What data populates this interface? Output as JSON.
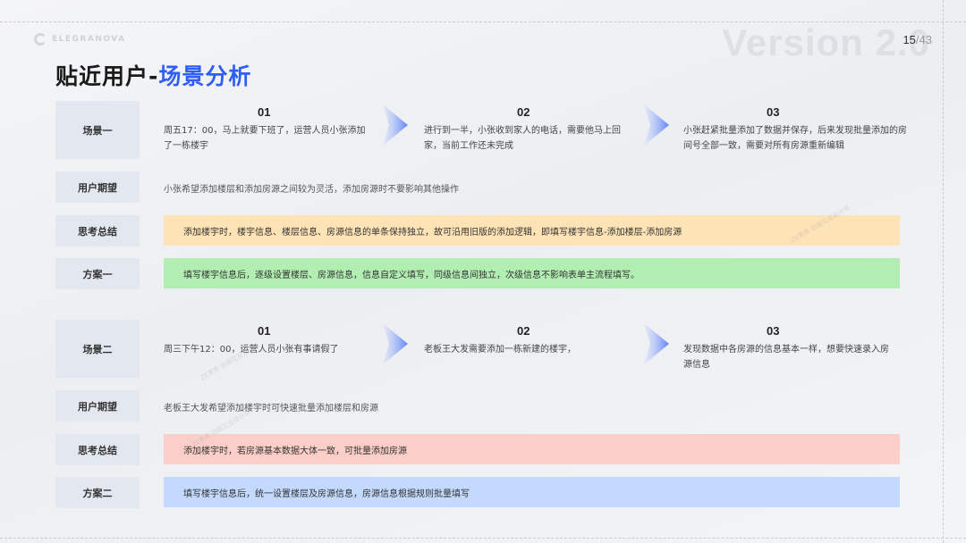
{
  "brand": {
    "logo_text": "ELEGRANOVA"
  },
  "watermark": {
    "version": "Version 2.0",
    "tiny": "ZE青秀 旧版交互设计师"
  },
  "page": {
    "current": "15",
    "total": "/43"
  },
  "title": {
    "main": "贴近用户-",
    "highlight": "场景分析"
  },
  "colors": {
    "accent": "#2f5ef5",
    "label_bg": "#e3e8f0",
    "bar_orange": "#fde3b5",
    "bar_green": "#b2eeb2",
    "bar_red": "#fbcfc8",
    "bar_blue": "#c3dafe"
  },
  "section1": {
    "scene_label": "场景一",
    "steps": [
      {
        "num": "01",
        "text": "周五17：00，马上就要下班了，运营人员小张添加了一栋楼宇"
      },
      {
        "num": "02",
        "text": "进行到一半，小张收到家人的电话，需要他马上回家，当前工作还未完成"
      },
      {
        "num": "03",
        "text": "小张赶紧批量添加了数据并保存，后来发现批量添加的房间号全部一致，需要对所有房源重新编辑"
      }
    ],
    "expect_label": "用户期望",
    "expect_text": "小张希望添加楼层和添加房源之间较为灵活，添加房源时不要影响其他操作",
    "summary_label": "思考总结",
    "summary_text": "添加楼宇时，楼宇信息、楼层信息、房源信息的单条保持独立，故可沿用旧版的添加逻辑，即填写楼宇信息-添加楼层-添加房源",
    "plan_label": "方案一",
    "plan_text": "填写楼宇信息后，逐级设置楼层、房源信息，信息自定义填写，同级信息间独立，次级信息不影响表单主流程填写。"
  },
  "section2": {
    "scene_label": "场景二",
    "steps": [
      {
        "num": "01",
        "text": "周三下午12：00，运营人员小张有事请假了"
      },
      {
        "num": "02",
        "text": "老板王大发需要添加一栋新建的楼宇，"
      },
      {
        "num": "03",
        "text": "发现数据中各房源的信息基本一样，想要快速录入房源信息"
      }
    ],
    "expect_label": "用户期望",
    "expect_text": "老板王大发希望添加楼宇时可快速批量添加楼层和房源",
    "summary_label": "思考总结",
    "summary_text": "添加楼宇时，若房源基本数据大体一致，可批量添加房源",
    "plan_label": "方案二",
    "plan_text": "填写楼宇信息后，统一设置楼层及房源信息，房源信息根据规则批量填写"
  }
}
